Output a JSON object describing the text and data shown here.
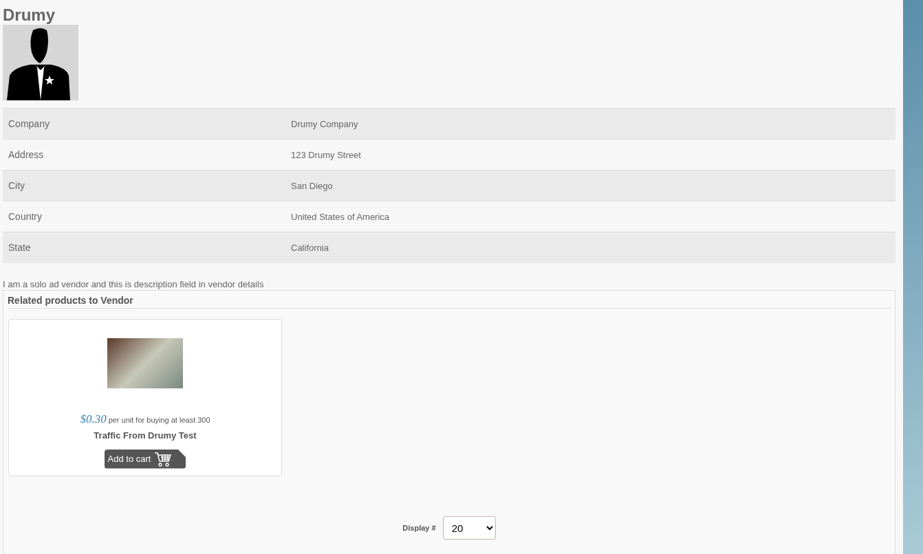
{
  "vendor": {
    "name": "Drumy"
  },
  "details": [
    {
      "label": "Company",
      "value": "Drumy Company"
    },
    {
      "label": "Address",
      "value": "123 Drumy Street"
    },
    {
      "label": "City",
      "value": "San Diego"
    },
    {
      "label": "Country",
      "value": "United States of America"
    },
    {
      "label": "State",
      "value": "California"
    }
  ],
  "description": "I am a solo ad vendor and this is description field in vendor details",
  "related": {
    "title": "Related products to Vendor",
    "products": [
      {
        "price": "$0.30",
        "price_note": "per unit for buying at least 300",
        "name": "Traffic From Drumy Test",
        "button": "Add to cart"
      }
    ]
  },
  "pagination": {
    "label": "Display #",
    "value": "20"
  }
}
